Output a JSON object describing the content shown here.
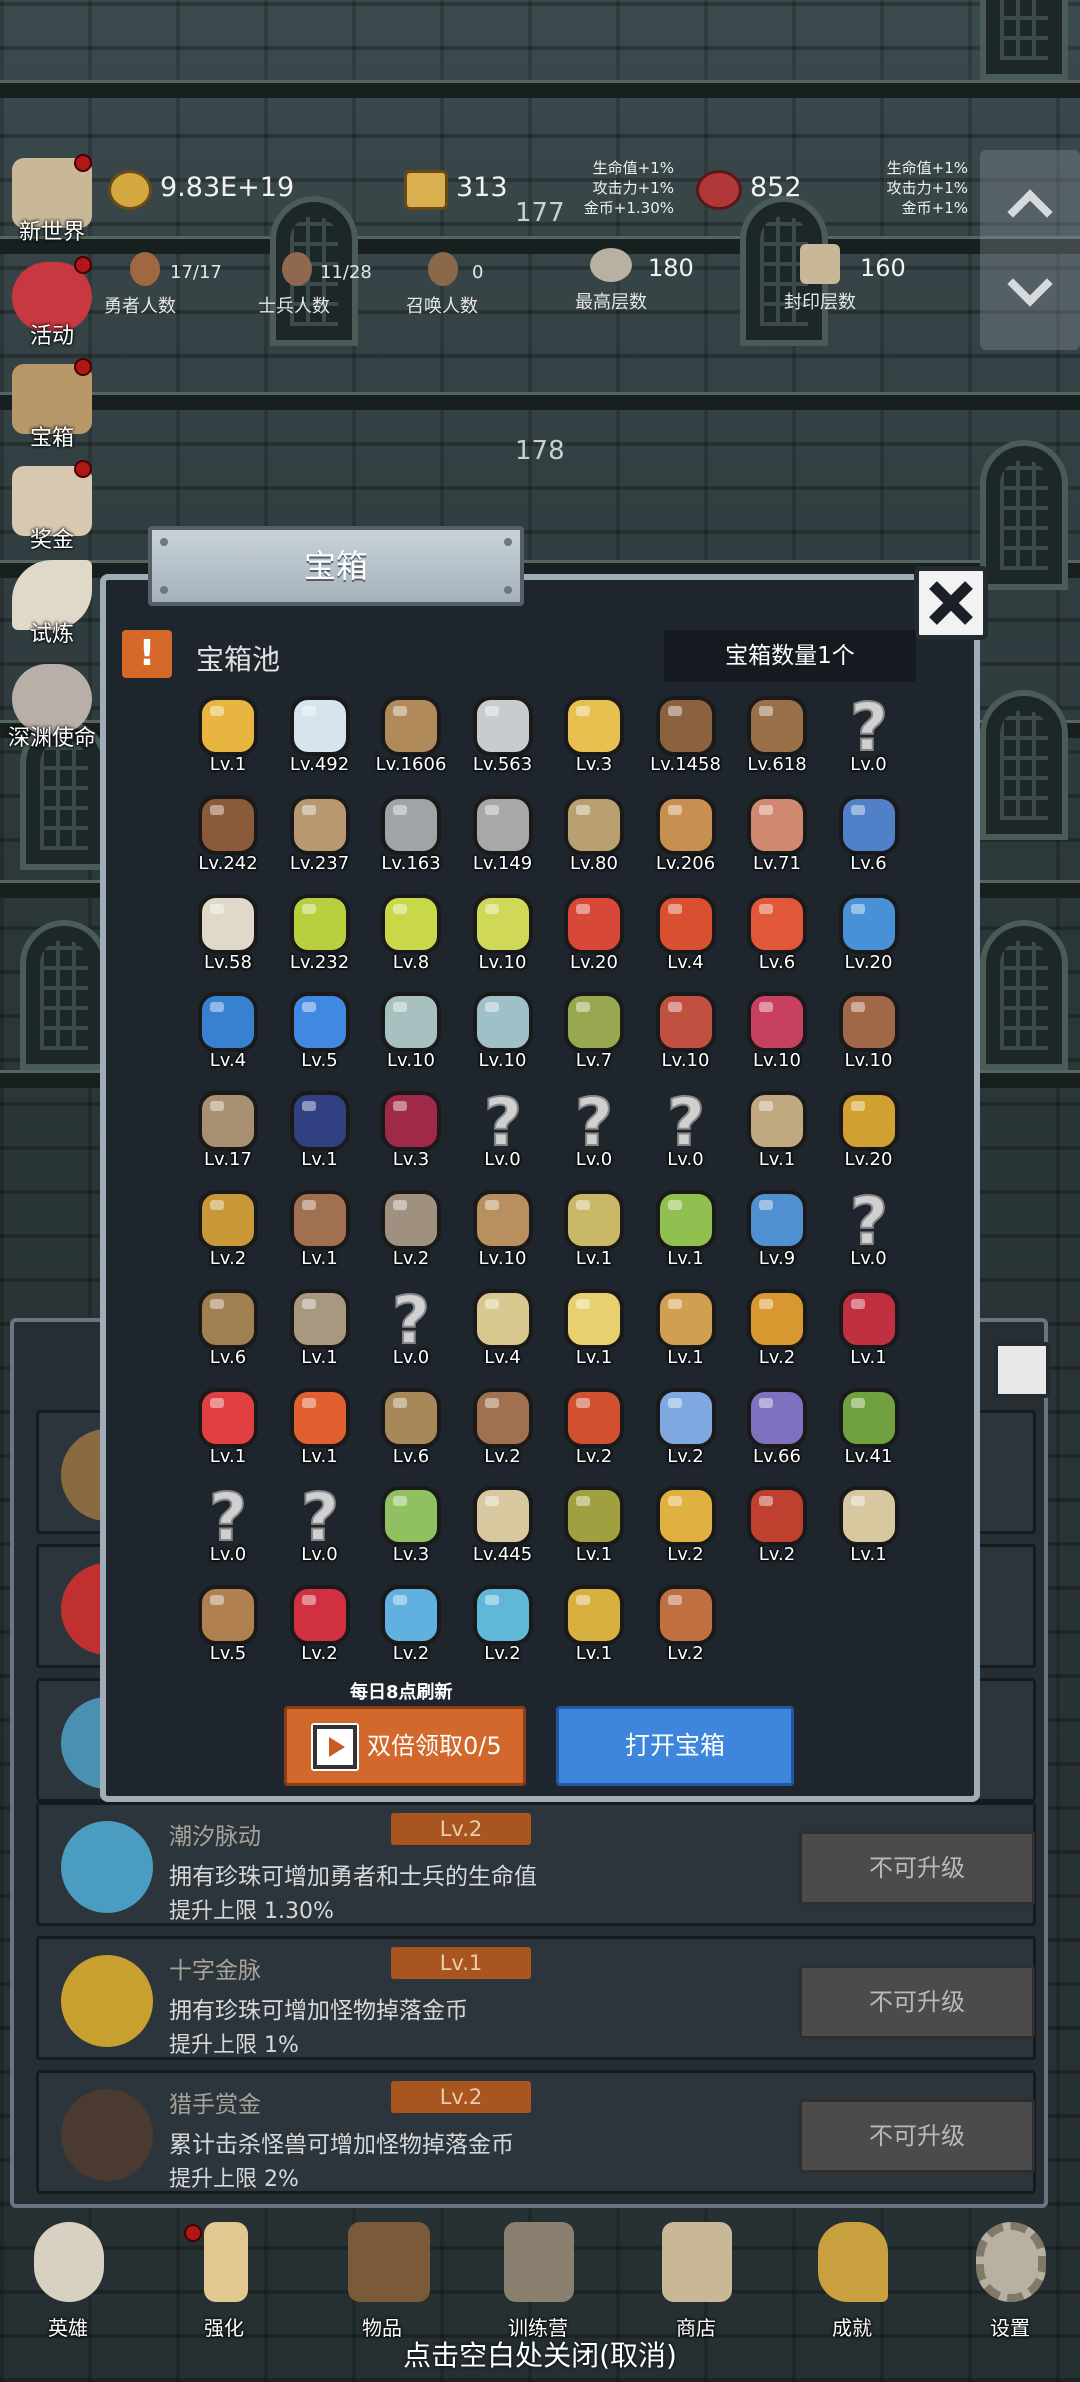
{
  "resources": {
    "gold": "9.83E+19",
    "bars": "313",
    "meat": "852",
    "floor_top": "177",
    "floor_mid": "178",
    "bonus_left": "生命值+1%\n攻击力+1%\n金币+1.30%",
    "bonus_right": "生命值+1%\n攻击力+1%\n金币+1%"
  },
  "counts": {
    "heroes_val": "17/17",
    "heroes_lbl": "勇者人数",
    "soldiers_val": "11/28",
    "soldiers_lbl": "士兵人数",
    "summon_val": "0",
    "summon_lbl": "召唤人数",
    "highest_val": "180",
    "highest_lbl": "最高层数",
    "sealed_val": "160",
    "sealed_lbl": "封印层数"
  },
  "left_menu": [
    "新世界",
    "活动",
    "宝箱",
    "奖金",
    "试炼",
    "深渊使命"
  ],
  "modal": {
    "title": "宝箱",
    "pool_title": "宝箱池",
    "count": "宝箱数量1个",
    "refresh": "每日8点刷新",
    "double_btn": "双倍领取0/5",
    "open_btn": "打开宝箱"
  },
  "items": [
    [
      "crown",
      "#e8b640",
      "Lv.1"
    ],
    [
      "diamond",
      "#d6e4ee",
      "Lv.492"
    ],
    [
      "sword-wood",
      "#b08a5a",
      "Lv.1606"
    ],
    [
      "sword-iron",
      "#c8ccd0",
      "Lv.563"
    ],
    [
      "sword-gold",
      "#e8c050",
      "Lv.3"
    ],
    [
      "armor-leather",
      "#8a6240",
      "Lv.1458"
    ],
    [
      "armor-backpack",
      "#9a7048",
      "Lv.618"
    ],
    [
      "unknown",
      "#cfcfcf",
      "Lv.0"
    ],
    [
      "helmet-leather",
      "#8a5a3a",
      "Lv.242"
    ],
    [
      "dagger",
      "#b89870",
      "Lv.237"
    ],
    [
      "helmet-knight",
      "#9ea4a8",
      "Lv.163"
    ],
    [
      "hammer",
      "#a8a8a8",
      "Lv.149"
    ],
    [
      "helmet-great",
      "#b8a070",
      "Lv.80"
    ],
    [
      "bread",
      "#c89050",
      "Lv.206"
    ],
    [
      "meat",
      "#d08870",
      "Lv.71"
    ],
    [
      "sack",
      "#5080c8",
      "Lv.6"
    ],
    [
      "flour",
      "#e0d8c8",
      "Lv.58"
    ],
    [
      "potion-yellow",
      "#b8d040",
      "Lv.232"
    ],
    [
      "potion-yellow2",
      "#c8d848",
      "Lv.8"
    ],
    [
      "potion-yellow3",
      "#d0d858",
      "Lv.10"
    ],
    [
      "potion-red",
      "#d84838",
      "Lv.20"
    ],
    [
      "potion-red2",
      "#d85030",
      "Lv.4"
    ],
    [
      "potion-red3",
      "#e05838",
      "Lv.6"
    ],
    [
      "potion-blue",
      "#4890d8",
      "Lv.20"
    ],
    [
      "potion-blue2",
      "#3880d0",
      "Lv.4"
    ],
    [
      "potion-blue3",
      "#4088e0",
      "Lv.5"
    ],
    [
      "bottle",
      "#a8c0c0",
      "Lv.10"
    ],
    [
      "bottle2",
      "#a0c0c8",
      "Lv.10"
    ],
    [
      "bottle-green",
      "#98a850",
      "Lv.7"
    ],
    [
      "bottle-red",
      "#c05040",
      "Lv.10"
    ],
    [
      "boot-wing",
      "#c84060",
      "Lv.10"
    ],
    [
      "boot",
      "#a06848",
      "Lv.10"
    ],
    [
      "boot-leather",
      "#a89070",
      "Lv.17"
    ],
    [
      "boot-cyan",
      "#304080",
      "Lv.1"
    ],
    [
      "boot-red",
      "#a02848",
      "Lv.3"
    ],
    [
      "unknown",
      "#cfcfcf",
      "Lv.0"
    ],
    [
      "unknown",
      "#cfcfcf",
      "Lv.0"
    ],
    [
      "unknown",
      "#cfcfcf",
      "Lv.0"
    ],
    [
      "knife",
      "#c0a880",
      "Lv.1"
    ],
    [
      "torch",
      "#d0a030",
      "Lv.20"
    ],
    [
      "torch2",
      "#c89838",
      "Lv.2"
    ],
    [
      "mushroom",
      "#a07050",
      "Lv.1"
    ],
    [
      "pickaxe",
      "#a09080",
      "Lv.2"
    ],
    [
      "cane",
      "#b89060",
      "Lv.10"
    ],
    [
      "potato",
      "#c8b868",
      "Lv.1"
    ],
    [
      "lime",
      "#90c050",
      "Lv.1"
    ],
    [
      "wand",
      "#5090d0",
      "Lv.9"
    ],
    [
      "unknown",
      "#cfcfcf",
      "Lv.0"
    ],
    [
      "backpack",
      "#a08050",
      "Lv.6"
    ],
    [
      "shovel",
      "#a89880",
      "Lv.1"
    ],
    [
      "unknown",
      "#cfcfcf",
      "Lv.0"
    ],
    [
      "spear",
      "#d8c890",
      "Lv.4"
    ],
    [
      "cheese",
      "#e8d070",
      "Lv.1"
    ],
    [
      "pie",
      "#d0a050",
      "Lv.1"
    ],
    [
      "jar",
      "#d89830",
      "Lv.2"
    ],
    [
      "crystal",
      "#c03040",
      "Lv.1"
    ],
    [
      "orb-red",
      "#e04040",
      "Lv.1"
    ],
    [
      "orb-fire",
      "#e06030",
      "Lv.1"
    ],
    [
      "bow",
      "#a88858",
      "Lv.6"
    ],
    [
      "quiver",
      "#a07050",
      "Lv.2"
    ],
    [
      "glove-fire",
      "#d05030",
      "Lv.2"
    ],
    [
      "rune-blue",
      "#80a8e0",
      "Lv.2"
    ],
    [
      "rune-purple",
      "#8070c0",
      "Lv.66"
    ],
    [
      "amulet-green",
      "#70a040",
      "Lv.41"
    ],
    [
      "unknown",
      "#cfcfcf",
      "Lv.0"
    ],
    [
      "unknown",
      "#cfcfcf",
      "Lv.0"
    ],
    [
      "staff-green",
      "#90c060",
      "Lv.3"
    ],
    [
      "mug",
      "#d8c8a0",
      "Lv.445"
    ],
    [
      "vine",
      "#a0a040",
      "Lv.1"
    ],
    [
      "pickaxe-gold",
      "#e0b040",
      "Lv.2"
    ],
    [
      "book-red",
      "#c04030",
      "Lv.2"
    ],
    [
      "scroll",
      "#d8c8a0",
      "Lv.1"
    ],
    [
      "whip",
      "#b08050",
      "Lv.5"
    ],
    [
      "card-red",
      "#d03040",
      "Lv.2"
    ],
    [
      "globe-blue",
      "#60b0e0",
      "Lv.2"
    ],
    [
      "disc-tide",
      "#60b8d8",
      "Lv.2"
    ],
    [
      "pearl-gold",
      "#d8b040",
      "Lv.1"
    ],
    [
      "arrow",
      "#c07040",
      "Lv.2"
    ]
  ],
  "upgrades": [
    {
      "name": "潮汐脉动",
      "lv": "Lv.2",
      "desc": "拥有珍珠可增加勇者和士兵的生命值",
      "up": "提升上限 1.30%",
      "btn": "不可升级",
      "color": "#4a9cc0"
    },
    {
      "name": "十字金脉",
      "lv": "Lv.1",
      "desc": "拥有珍珠可增加怪物掉落金币",
      "up": "提升上限 1%",
      "btn": "不可升级",
      "color": "#c8a030"
    },
    {
      "name": "猎手赏金",
      "lv": "Lv.2",
      "desc": "累计击杀怪兽可增加怪物掉落金币",
      "up": "提升上限 2%",
      "btn": "不可升级",
      "color": "#b06030"
    }
  ],
  "nav": [
    "英雄",
    "强化",
    "物品",
    "训练营",
    "商店",
    "成就",
    "设置"
  ],
  "close_hint": "点击空白处关闭(取消)"
}
